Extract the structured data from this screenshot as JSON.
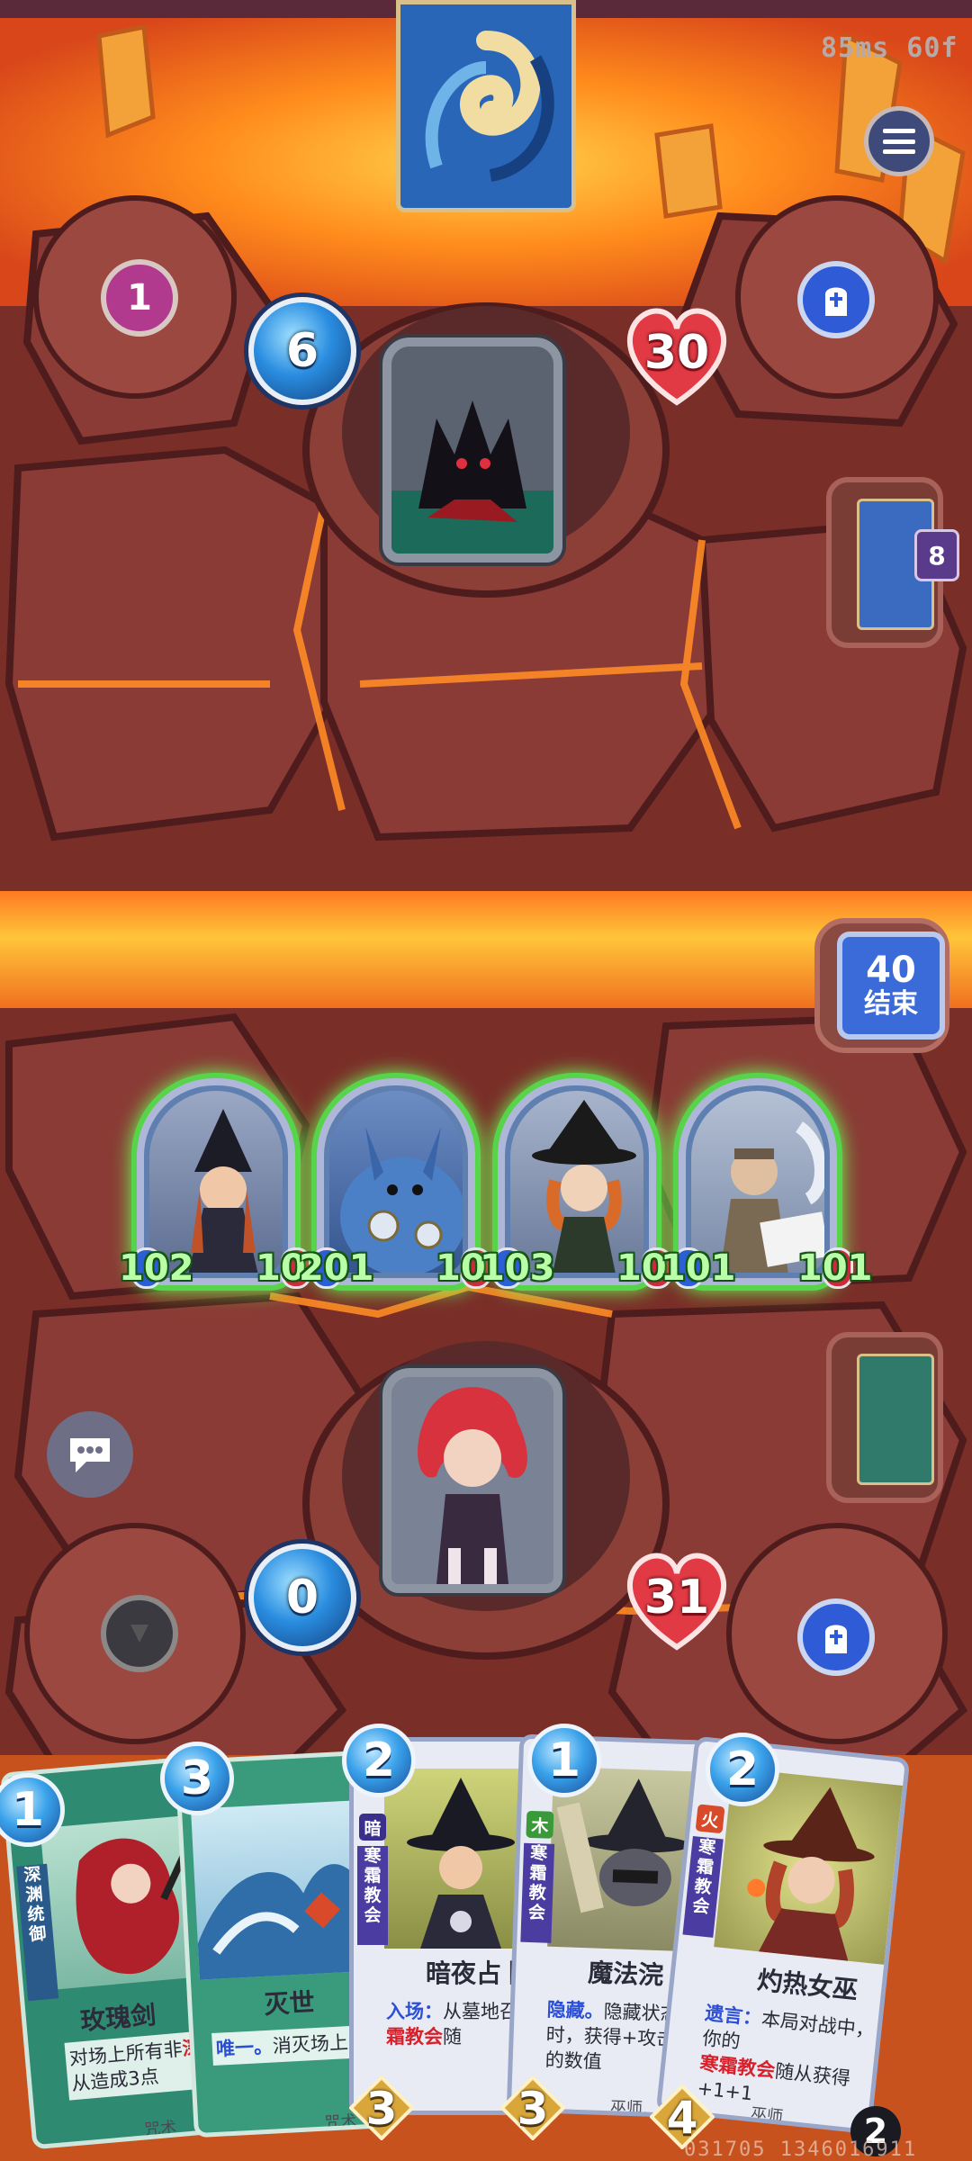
{
  "hud": {
    "latency": "85ms 60f"
  },
  "opponent": {
    "round_badge": "1",
    "mana": "6",
    "health": "30",
    "deck_count": "8"
  },
  "end_turn": {
    "timer": "40",
    "label": "结束"
  },
  "board": {
    "minions": [
      {
        "attack": "102",
        "health": "102"
      },
      {
        "attack": "201",
        "health": "101"
      },
      {
        "attack": "103",
        "health": "101"
      },
      {
        "attack": "101",
        "health": "101"
      }
    ]
  },
  "player": {
    "mana": "0",
    "health": "31"
  },
  "hand": [
    {
      "cost": "1",
      "name": "玫瑰剑",
      "tribe": "深渊统御",
      "text": "对场上所有非",
      "text_red": "深",
      "text2": "从造成3点",
      "type": "咒术"
    },
    {
      "cost": "3",
      "name": "灭世",
      "tribe": "",
      "text_kw": "唯一。",
      "text": "消灭场上",
      "type": "咒术"
    },
    {
      "cost": "2",
      "name": "暗夜占卜",
      "element": "暗",
      "tribe": "寒霜教会",
      "text_kw": "入场：",
      "text": "从墓地召",
      "text_red": "霜教会",
      "text2": "随",
      "attack": "3",
      "type": ""
    },
    {
      "cost": "1",
      "name": "魔法浣",
      "element": "木",
      "tribe": "寒霜教会",
      "text_kw": "隐藏。",
      "text": "隐藏状态",
      "text2": "时，获得+攻击",
      "text3": "的数值",
      "attack": "3",
      "type": "巫师,"
    },
    {
      "cost": "2",
      "name": "灼热女巫",
      "element": "火",
      "tribe": "寒霜教会",
      "text_kw": "遗言：",
      "text": "本局对战中，你的",
      "text_red": "寒霜教会",
      "text2": "随从获得+1+1",
      "attack": "4",
      "type": "巫师",
      "corner": "2"
    }
  ],
  "footer": {
    "id_text": "031705 1346016911"
  }
}
